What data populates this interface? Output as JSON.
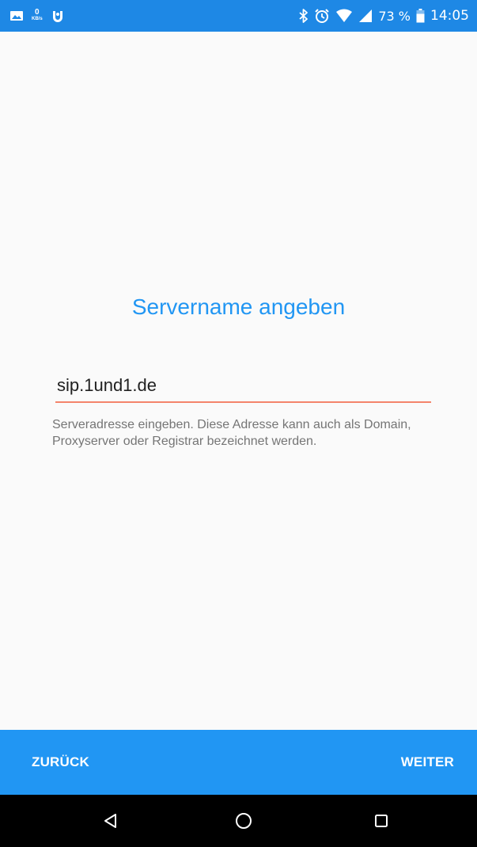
{
  "status_bar": {
    "left_icons": [
      "image-icon",
      "kbs-indicator",
      "app-notification-icon"
    ],
    "kbs_value": "0",
    "kbs_unit": "KB/s",
    "right_icons": [
      "bluetooth-icon",
      "alarm-icon",
      "wifi-icon",
      "signal-icon",
      "battery-icon"
    ],
    "battery_percent": "73 %",
    "time": "14:05"
  },
  "page": {
    "title": "Servername angeben",
    "server_input_value": "sip.1und1.de",
    "help_text": "Serveradresse eingeben. Diese Adresse kann auch als Domain, Proxyserver oder Registrar bezeichnet werden."
  },
  "actions": {
    "back_label": "ZURÜCK",
    "next_label": "WEITER"
  },
  "nav_bar": {
    "buttons": [
      "back-icon",
      "home-icon",
      "recents-icon"
    ]
  },
  "colors": {
    "status_bar": "#1e88e5",
    "accent": "#2196f3",
    "input_underline": "#f4846b",
    "background": "#fafafa",
    "help_text": "#757575",
    "nav_bar": "#000000"
  }
}
